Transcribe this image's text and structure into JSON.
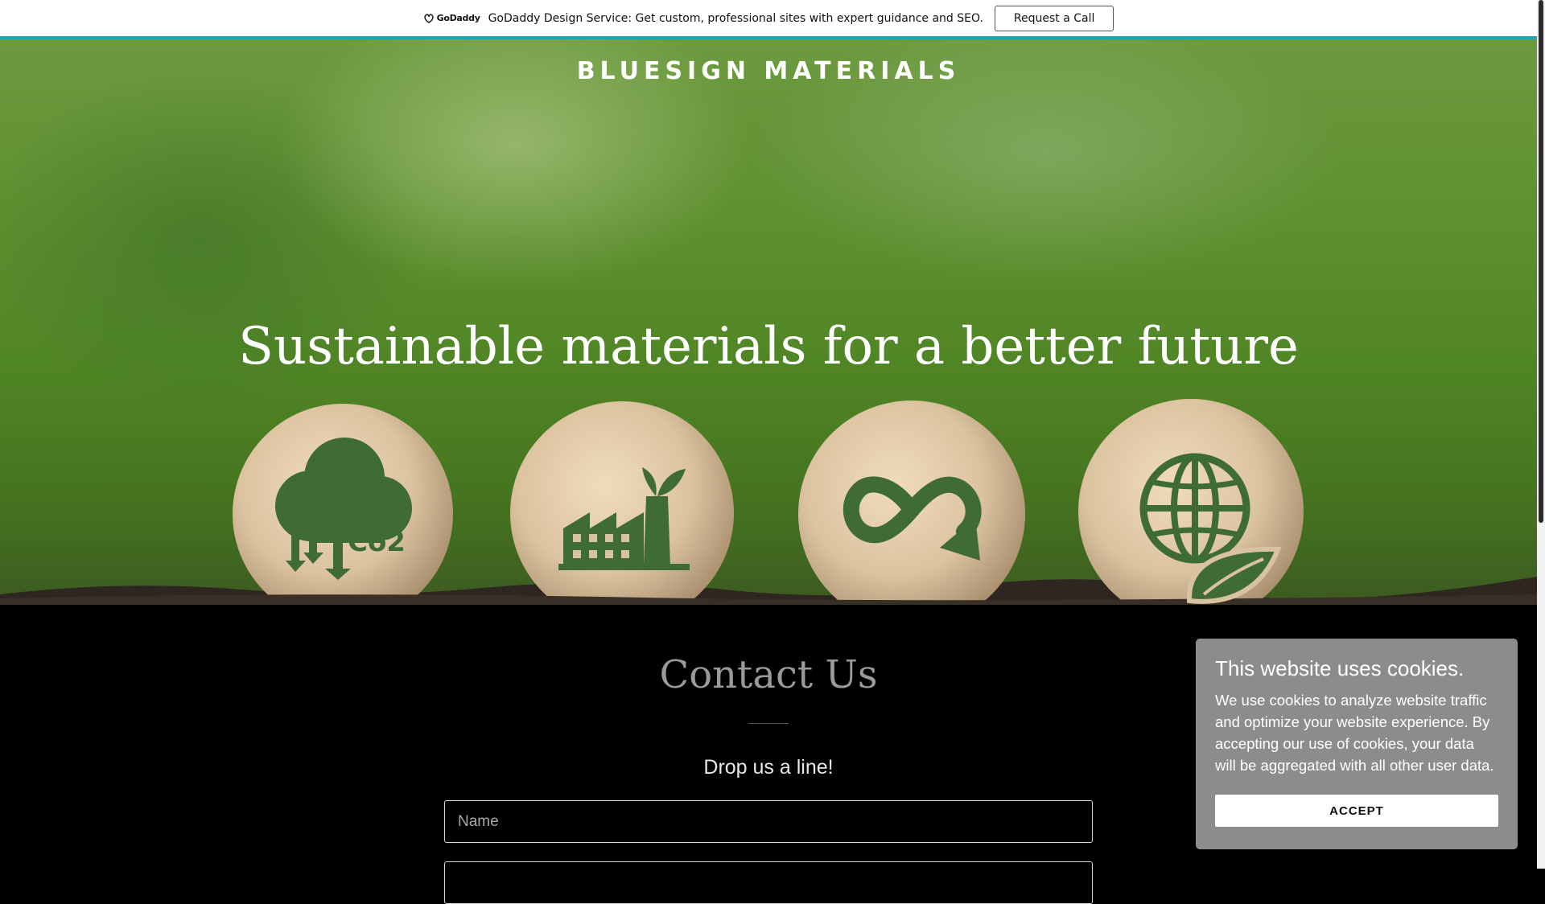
{
  "promo": {
    "logo_text": "GoDaddy",
    "text": "GoDaddy Design Service: Get custom, professional sites with expert guidance and SEO.",
    "button": "Request a Call"
  },
  "hero": {
    "brand": "BLUESIGN MATERIALS",
    "tagline": "Sustainable materials for a better future",
    "sphere_icons": [
      "co2-reduction-icon",
      "eco-factory-icon",
      "infinity-recycle-icon",
      "globe-leaf-icon"
    ],
    "sphere_labels": [
      "Co2"
    ]
  },
  "contact": {
    "title": "Contact Us",
    "subtitle": "Drop us a line!",
    "name_placeholder": "Name"
  },
  "cookie": {
    "title": "This website uses cookies.",
    "body": "We use cookies to analyze website traffic and optimize your website experience. By accepting our use of cookies, your data will be aggregated with all other user data.",
    "button": "ACCEPT"
  },
  "colors": {
    "accent_bar": "#1ba6b5",
    "icon_green": "#3f6b37",
    "cookie_bg": "#8c8c8c"
  }
}
